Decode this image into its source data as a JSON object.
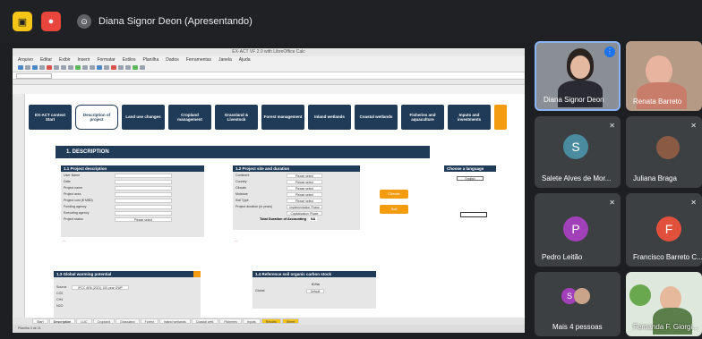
{
  "topbar": {
    "presenter_label": "Diana Signor Deon (Apresentando)"
  },
  "calc": {
    "window_title": "EX-ACT VF 2.0 with LibreOffice Calc",
    "menu": [
      "Arquivo",
      "Editar",
      "Exibir",
      "Inserir",
      "Formatar",
      "Estilos",
      "Planilha",
      "Dados",
      "Ferramentas",
      "Janela",
      "Ajuda"
    ],
    "nav_tiles": [
      "EX-ACT context Start",
      "Description of project",
      "Land use changes",
      "Cropland management",
      "Grassland & Livestock",
      "Forest management",
      "Inland wetlands",
      "Coastal wetlands",
      "Fisheries and aquaculture",
      "Inputs and investments",
      ""
    ],
    "section_title": "1. DESCRIPTION",
    "panel_project": {
      "title": "1.1 Project description",
      "fields": [
        "User Name",
        "Date",
        "Project name",
        "Project area",
        "Project cost (€ M$D)",
        "Funding agency",
        "Executing agency",
        "Project status"
      ],
      "status_value": "Please select"
    },
    "panel_site": {
      "title": "1.2 Project site and duration",
      "fields": [
        "Continent",
        "Country",
        "Climate",
        "Moisture",
        "Soil Type",
        "Project duration (in years)"
      ],
      "values": [
        "Please select",
        "Please select",
        "Please select",
        "Please select",
        "Please select"
      ],
      "implementation": "Implementation Phase",
      "capitalization": "Capitalization Phase",
      "total_label": "Total Duration of Accounting",
      "total_value": "NA"
    },
    "buttons": {
      "btn1": "Climate",
      "btn2": "Soil"
    },
    "language": {
      "title": "Choose a language",
      "value": "English"
    },
    "panel_warming": {
      "title": "1.3 Global warming potential",
      "source_label": "Source",
      "source_value": "IPCC AR6 (2021) 100-year GWP",
      "gases": [
        "CO2",
        "CH4",
        "N2O"
      ]
    },
    "panel_soil": {
      "title": "1.4 Reference soil organic carbon stock",
      "label": "tC/ha",
      "global_label": "Global",
      "value": "Default"
    },
    "sheet_tabs": [
      "Start",
      "Description",
      "LUC",
      "Cropland",
      "Grassland",
      "Forest",
      "Inland wetlands",
      "Coastal wetl.",
      "Fisheries",
      "Inputs",
      "Results",
      "Sheet"
    ],
    "status_text": "Planilha 3 de 21"
  },
  "participants": [
    {
      "name": "Diana Signor Deon"
    },
    {
      "name": "Renata Barreto"
    },
    {
      "name": "Salete Alves de Mor...",
      "initial": "S",
      "color": "#4a8ba0"
    },
    {
      "name": "Juliana Braga"
    },
    {
      "name": "Pedro Leitão",
      "initial": "P",
      "color": "#a140b8"
    },
    {
      "name": "Francisco Barreto C...",
      "initial": "F",
      "color": "#e0503a"
    },
    {
      "name": "Mais 4 pessoas",
      "initial": "S",
      "color": "#a140b8"
    },
    {
      "name": "Fernanda F. Giorgi..."
    }
  ]
}
